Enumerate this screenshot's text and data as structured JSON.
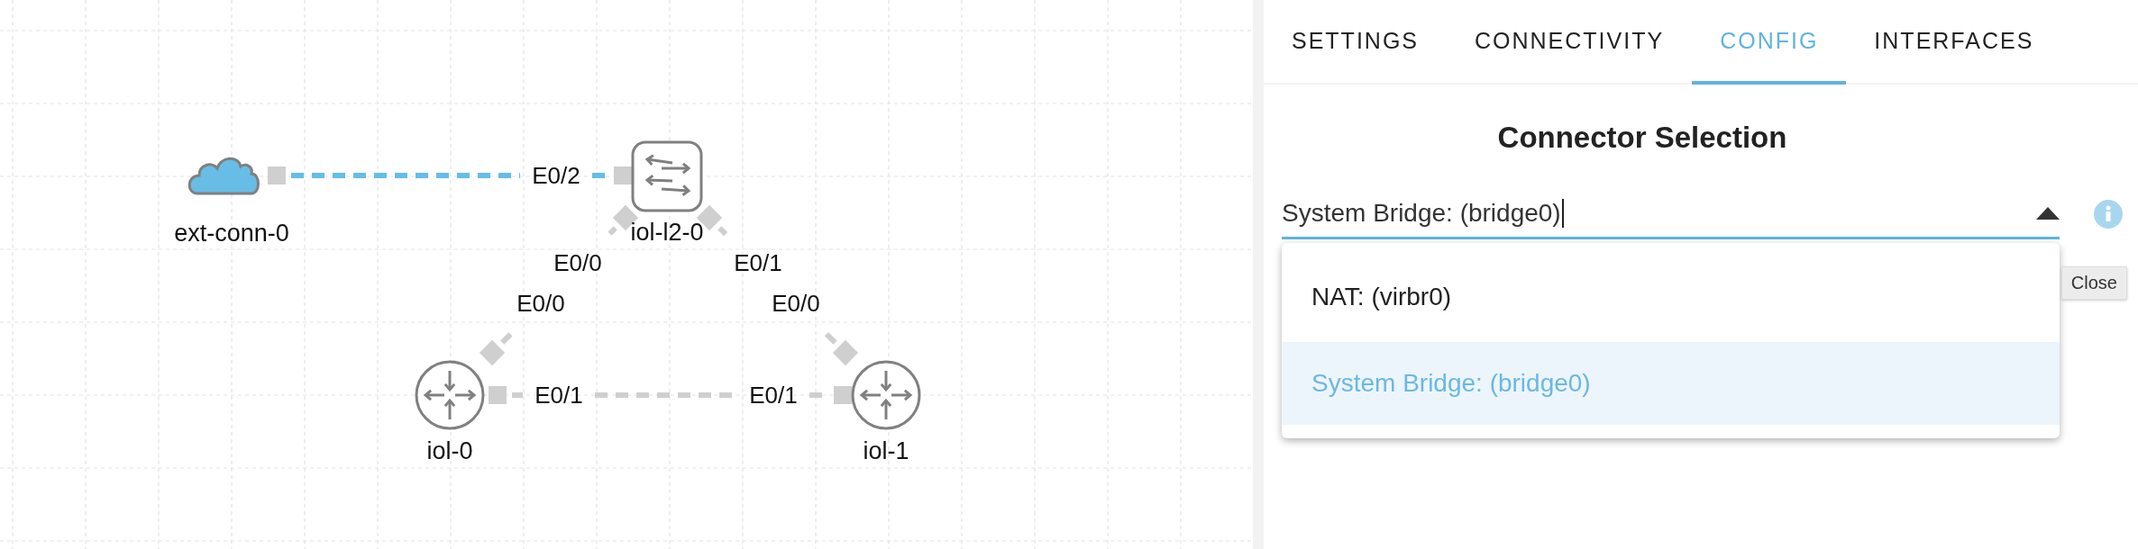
{
  "topology": {
    "nodes": [
      {
        "kind": "cloud",
        "label": "ext-conn-0"
      },
      {
        "kind": "switch",
        "label": "iol-l2-0"
      },
      {
        "kind": "router",
        "label": "iol-0"
      },
      {
        "kind": "router",
        "label": "iol-1"
      }
    ],
    "links": [
      {
        "kind": "external",
        "end_labels": [
          "E0/2"
        ]
      },
      {
        "kind": "ethernet",
        "end_labels": [
          "E0/0",
          "E0/0"
        ]
      },
      {
        "kind": "ethernet",
        "end_labels": [
          "E0/1",
          "E0/0"
        ]
      },
      {
        "kind": "ethernet",
        "end_labels": [
          "E0/1",
          "E0/1"
        ]
      }
    ]
  },
  "panel": {
    "tabs": [
      {
        "label": "SETTINGS",
        "selected": false
      },
      {
        "label": "CONNECTIVITY",
        "selected": false
      },
      {
        "label": "CONFIG",
        "selected": true
      },
      {
        "label": "INTERFACES",
        "selected": false
      }
    ],
    "section_title": "Connector Selection",
    "connector_field": {
      "value": "System Bridge: (bridge0)",
      "expanded": true,
      "options": [
        {
          "label": "NAT: (virbr0)",
          "selected": false
        },
        {
          "label": "System Bridge: (bridge0)",
          "selected": true
        }
      ]
    },
    "tooltip": "Close"
  }
}
